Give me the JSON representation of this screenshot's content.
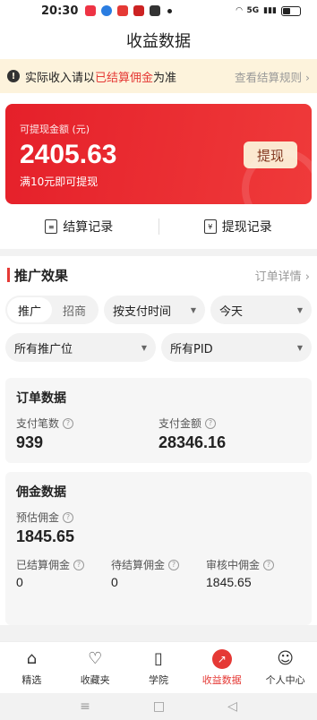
{
  "status": {
    "time": "20:30",
    "net": "5G"
  },
  "title": "收益数据",
  "notice": {
    "pre": "实际收入请以",
    "highlight": "已结算佣金",
    "post": "为准",
    "link": "查看结算规则 ›"
  },
  "card": {
    "label": "可提现金额 (元)",
    "amount": "2405.63",
    "min_note": "满10元即可提现",
    "withdraw": "提现"
  },
  "records": {
    "settle": "结算记录",
    "withdraw": "提现记录"
  },
  "promo": {
    "title": "推广效果",
    "detail": "订单详情 ›"
  },
  "filters": {
    "seg_a": "推广",
    "seg_b": "招商",
    "time_by": "按支付时间",
    "range": "今天",
    "position": "所有推广位",
    "pid": "所有PID"
  },
  "orders": {
    "title": "订单数据",
    "count_label": "支付笔数",
    "count": "939",
    "amount_label": "支付金额",
    "amount": "28346.16"
  },
  "commission": {
    "title": "佣金数据",
    "est_label": "预估佣金",
    "est": "1845.65",
    "settled_label": "已结算佣金",
    "settled": "0",
    "pending_label": "待结算佣金",
    "pending": "0",
    "review_label": "审核中佣金",
    "review": "1845.65"
  },
  "tabs": [
    "精选",
    "收藏夹",
    "学院",
    "收益数据",
    "个人中心"
  ],
  "colors": {
    "accent": "#e53935",
    "notice_bg": "#fdf3dc"
  }
}
